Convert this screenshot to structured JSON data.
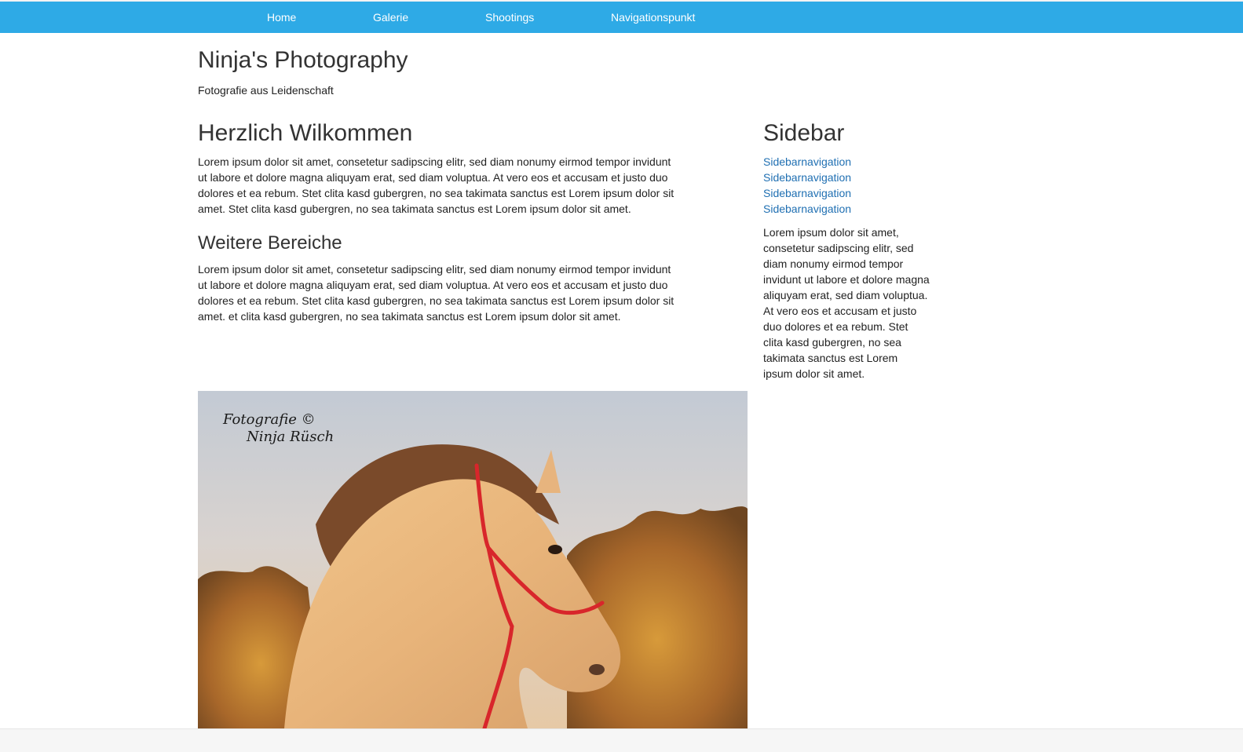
{
  "nav": {
    "items": [
      "Home",
      "Galerie",
      "Shootings",
      "Navigationspunkt"
    ]
  },
  "header": {
    "title": "Ninja's Photography",
    "tagline": "Fotografie aus Leidenschaft"
  },
  "main": {
    "welcome_heading": "Herzlich Wilkommen",
    "welcome_text": "Lorem ipsum dolor sit amet, consetetur sadipscing elitr, sed diam nonumy eirmod tempor invidunt ut labore et dolore magna aliquyam erat, sed diam voluptua. At vero eos et accusam et justo duo dolores et ea rebum. Stet clita kasd gubergren, no sea takimata sanctus est Lorem ipsum dolor sit amet. Stet clita kasd gubergren, no sea takimata sanctus est Lorem ipsum dolor sit amet.",
    "more_heading": "Weitere Bereiche",
    "more_text": "Lorem ipsum dolor sit amet, consetetur sadipscing elitr, sed diam nonumy eirmod tempor invidunt ut labore et dolore magna aliquyam erat, sed diam voluptua. At vero eos et accusam et justo duo dolores et ea rebum. Stet clita kasd gubergren, no sea takimata sanctus est Lorem ipsum dolor sit amet. et clita kasd gubergren, no sea takimata sanctus est Lorem ipsum dolor sit amet."
  },
  "sidebar": {
    "heading": "Sidebar",
    "links": [
      "Sidebarnavigation",
      "Sidebarnavigation",
      "Sidebarnavigation",
      "Sidebarnavigation"
    ],
    "text": "Lorem ipsum dolor sit amet, consetetur sadipscing elitr, sed diam nonumy eirmod tempor invidunt ut labore et dolore magna aliquyam erat, sed diam voluptua. At vero eos et accusam et justo duo dolores et ea rebum. Stet clita kasd gubergren, no sea takimata sanctus est Lorem ipsum dolor sit amet."
  },
  "photo": {
    "watermark_line1": "Fotografie ©",
    "watermark_line2": "Ninja Rüsch"
  },
  "colors": {
    "nav_bg": "#2eaae6",
    "link": "#1f6fb2",
    "halter": "#d8262b"
  }
}
